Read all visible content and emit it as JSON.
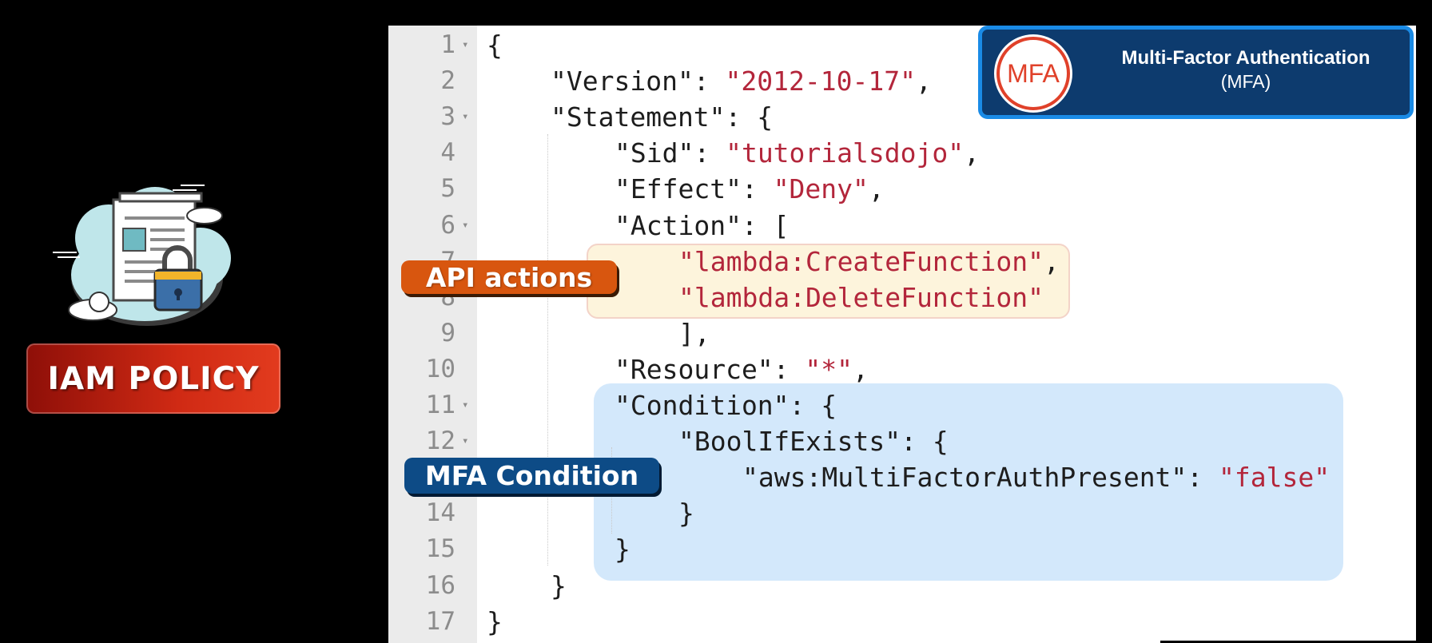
{
  "badge": {
    "label": "IAM POLICY"
  },
  "mfa_card": {
    "icon_text": "MFA",
    "title": "Multi-Factor Authentication",
    "subtitle": "(MFA)"
  },
  "callouts": {
    "api": "API actions",
    "mfa": "MFA Condition"
  },
  "colors": {
    "string": "#b3263b",
    "callout_api": "#d8560f",
    "callout_mfa": "#0d4b86",
    "badge_red": "#d02a14"
  },
  "editor": {
    "lines": [
      {
        "n": "1",
        "fold": true,
        "indent": 0,
        "key": "",
        "text": "{",
        "str": "",
        "tail": ""
      },
      {
        "n": "2",
        "fold": false,
        "indent": 1,
        "key": "\"Version\": ",
        "str": "\"2012-10-17\"",
        "tail": ","
      },
      {
        "n": "3",
        "fold": true,
        "indent": 1,
        "key": "\"Statement\": {",
        "str": "",
        "tail": ""
      },
      {
        "n": "4",
        "fold": false,
        "indent": 2,
        "key": "\"Sid\": ",
        "str": "\"tutorialsdojo\"",
        "tail": ","
      },
      {
        "n": "5",
        "fold": false,
        "indent": 2,
        "key": "\"Effect\": ",
        "str": "\"Deny\"",
        "tail": ","
      },
      {
        "n": "6",
        "fold": true,
        "indent": 2,
        "key": "\"Action\": [",
        "str": "",
        "tail": ""
      },
      {
        "n": "7",
        "fold": false,
        "indent": 3,
        "key": "",
        "str": "\"lambda:CreateFunction\"",
        "tail": ","
      },
      {
        "n": "8",
        "fold": false,
        "indent": 3,
        "key": "",
        "str": "\"lambda:DeleteFunction\"",
        "tail": ""
      },
      {
        "n": "9",
        "fold": false,
        "indent": 3,
        "key": "],",
        "str": "",
        "tail": ""
      },
      {
        "n": "10",
        "fold": false,
        "indent": 2,
        "key": "\"Resource\": ",
        "str": "\"*\"",
        "tail": ","
      },
      {
        "n": "11",
        "fold": true,
        "indent": 2,
        "key": "\"Condition\": {",
        "str": "",
        "tail": ""
      },
      {
        "n": "12",
        "fold": true,
        "indent": 3,
        "key": "\"BoolIfExists\": {",
        "str": "",
        "tail": ""
      },
      {
        "n": "13",
        "fold": false,
        "indent": 4,
        "key": "\"aws:MultiFactorAuthPresent\": ",
        "str": "\"false\"",
        "tail": ""
      },
      {
        "n": "14",
        "fold": false,
        "indent": 3,
        "key": "}",
        "str": "",
        "tail": ""
      },
      {
        "n": "15",
        "fold": false,
        "indent": 2,
        "key": "}",
        "str": "",
        "tail": ""
      },
      {
        "n": "16",
        "fold": false,
        "indent": 1,
        "key": "}",
        "str": "",
        "tail": ""
      },
      {
        "n": "17",
        "fold": false,
        "indent": 0,
        "key": "}",
        "str": "",
        "tail": ""
      }
    ]
  }
}
